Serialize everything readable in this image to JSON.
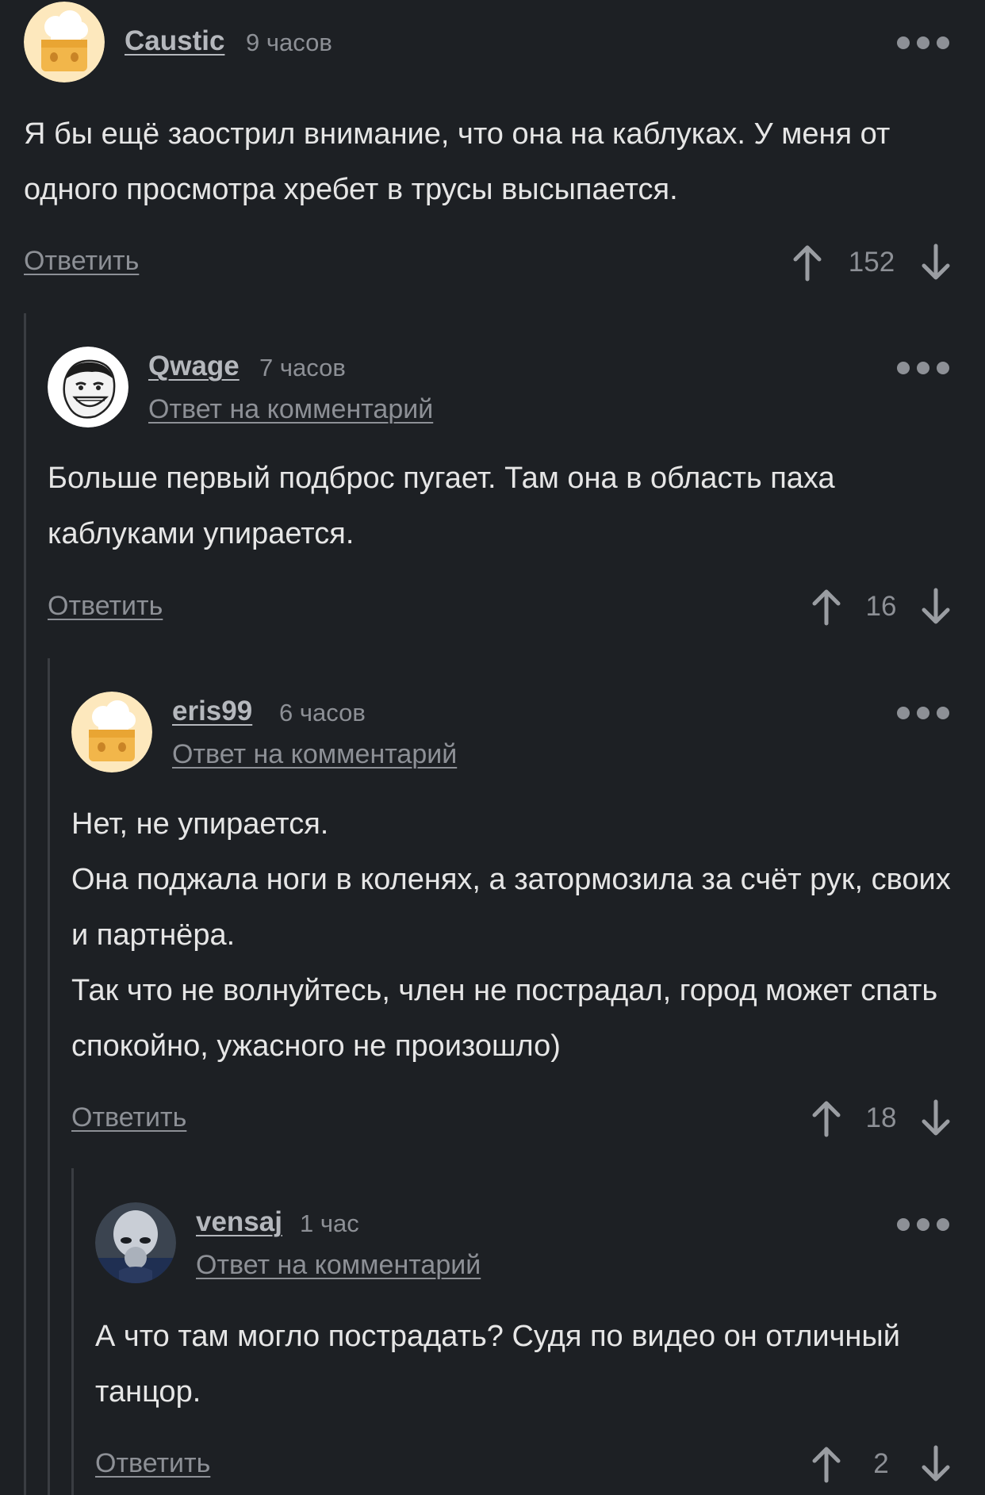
{
  "comments": [
    {
      "author": "Caustic",
      "time": "9 часов",
      "reply_to": "",
      "body": [
        "Я бы ещё заострил внимание, что она на каблуках. У меня от одного просмотра хребет в трусы высыпается."
      ],
      "reply_label": "Ответить",
      "votes": "152",
      "avatar": "chef-hat-avatar-icon"
    },
    {
      "author": "Qwage",
      "time": "7 часов",
      "reply_to": "Ответ на комментарий",
      "body": [
        "Больше первый подброс пугает. Там она в область паха каблуками упирается."
      ],
      "reply_label": "Ответить",
      "votes": "16",
      "avatar": "meme-face-avatar-icon"
    },
    {
      "author": "eris99",
      "time": "6 часов",
      "reply_to": "Ответ на комментарий",
      "body": [
        "Нет, не упирается.",
        "Она поджала ноги в коленях, а затормозила за счёт рук, своих и партнёра.",
        "Так что не волнуйтесь, член не пострадал, город может спать спокойно, ужасного не произошло)"
      ],
      "reply_label": "Ответить",
      "votes": "18",
      "avatar": "chef-hat-avatar-icon"
    },
    {
      "author": "vensaj",
      "time": "1 час",
      "reply_to": "Ответ на комментарий",
      "body": [
        "А что там могло пострадать? Судя по видео он отличный танцор."
      ],
      "reply_label": "Ответить",
      "votes": "2",
      "avatar": "alien-avatar-icon"
    }
  ]
}
